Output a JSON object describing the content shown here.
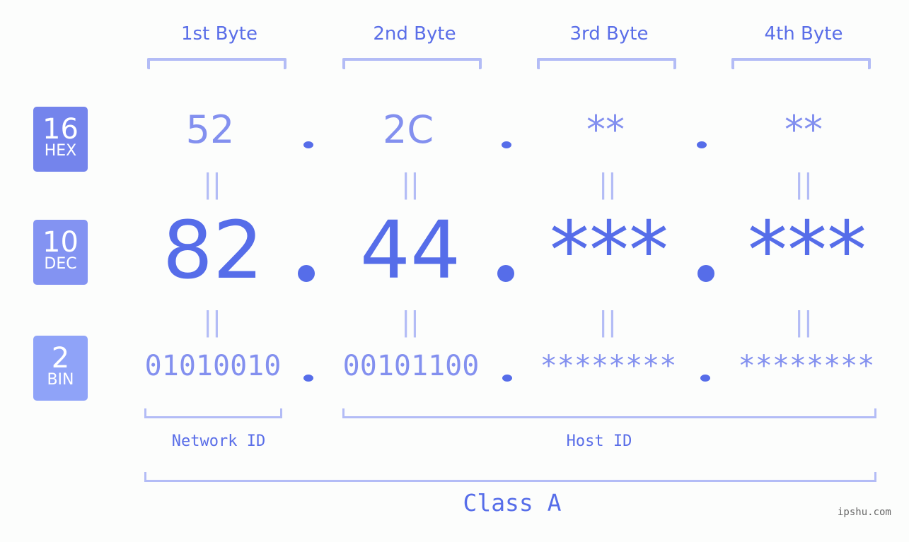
{
  "columns": [
    "1st Byte",
    "2nd Byte",
    "3rd Byte",
    "4th Byte"
  ],
  "badges": {
    "hex": {
      "number": "16",
      "label": "HEX",
      "color": "#7484ec"
    },
    "dec": {
      "number": "10",
      "label": "DEC",
      "color": "#8393f2"
    },
    "bin": {
      "number": "2",
      "label": "BIN",
      "color": "#8fa3f8"
    }
  },
  "hex": [
    "52",
    "2C",
    "**",
    "**"
  ],
  "dec": [
    "82",
    "44",
    "***",
    "***"
  ],
  "bin": [
    "01010010",
    "00101100",
    "********",
    "********"
  ],
  "separator": ".",
  "equals": "||",
  "network_label": "Network ID",
  "host_label": "Host ID",
  "class_label": "Class A",
  "watermark": "ipshu.com",
  "colors": {
    "accent": "#566de9",
    "light": "#8390ef",
    "bracket": "#b3bcf6"
  }
}
